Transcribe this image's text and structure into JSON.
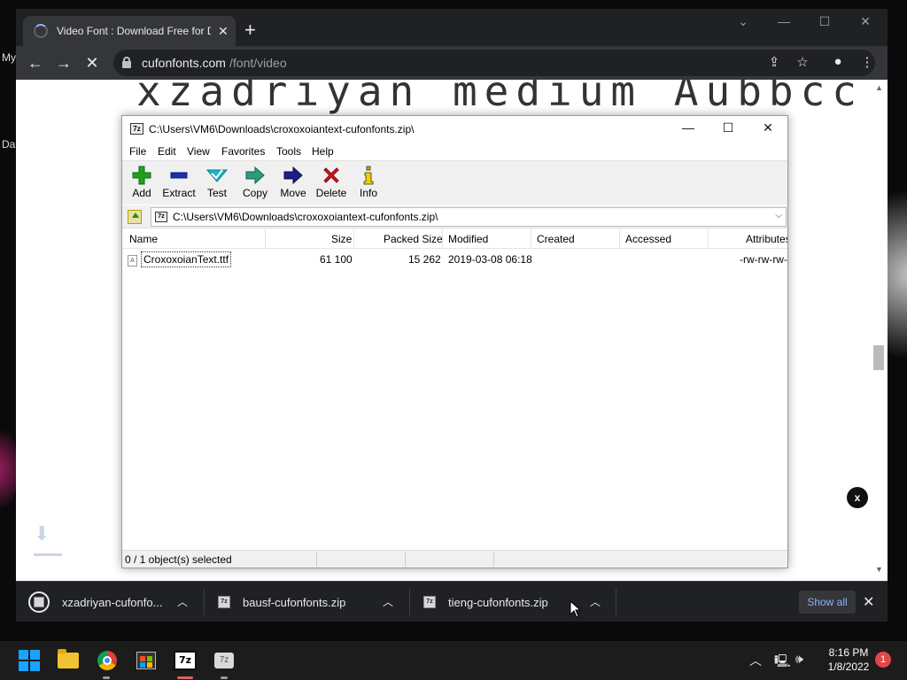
{
  "desktop": {
    "text_1": "My",
    "text_2": "Da"
  },
  "browser": {
    "tab": {
      "title": "Video Font : Download Free for Desktop & Webfont"
    },
    "address": {
      "host": "cufonfonts.com",
      "path": "/font/video"
    },
    "page": {
      "heading": "xzadriyan medium Aubbcc"
    },
    "close_overlay_label": "x"
  },
  "downloads_bar": {
    "items": [
      {
        "name": "xzadriyan-cufonfo..."
      },
      {
        "name": "bausf-cufonfonts.zip"
      },
      {
        "name": "tieng-cufonfonts.zip"
      }
    ],
    "show_all_label": "Show all"
  },
  "sevenzip": {
    "title": "C:\\Users\\VM6\\Downloads\\croxoxoiantext-cufonfonts.zip\\",
    "menu": [
      "File",
      "Edit",
      "View",
      "Favorites",
      "Tools",
      "Help"
    ],
    "toolbar": [
      {
        "label": "Add",
        "icon": "plus-icon",
        "color": "#1fa01f"
      },
      {
        "label": "Extract",
        "icon": "minus-icon",
        "color": "#1a2fb8"
      },
      {
        "label": "Test",
        "icon": "check-arrow-icon",
        "color": "#18b8c8"
      },
      {
        "label": "Copy",
        "icon": "double-arrow-icon",
        "color": "#2a9a80"
      },
      {
        "label": "Move",
        "icon": "right-arrow-icon",
        "color": "#1a1f80"
      },
      {
        "label": "Delete",
        "icon": "x-icon",
        "color": "#d01818"
      },
      {
        "label": "Info",
        "icon": "info-icon",
        "color": "#c8a800"
      }
    ],
    "address": "C:\\Users\\VM6\\Downloads\\croxoxoiantext-cufonfonts.zip\\",
    "columns": [
      "Name",
      "Size",
      "Packed Size",
      "Modified",
      "Created",
      "Accessed",
      "Attributes"
    ],
    "rows": [
      {
        "name": "CroxoxoianText.ttf",
        "size": "61 100",
        "packed_size": "15 262",
        "modified": "2019-03-08 06:18",
        "created": "",
        "accessed": "",
        "attributes": "-rw-rw-rw-"
      }
    ],
    "status": "0 / 1 object(s) selected"
  },
  "taskbar": {
    "time": "8:16 PM",
    "date": "1/8/2022",
    "notification_count": "1",
    "apps": [
      "windows-start-icon",
      "file-explorer-icon",
      "chrome-icon",
      "microsoft-store-icon",
      "7zip-icon",
      "app-icon"
    ]
  },
  "colors": {
    "chrome_dark": "#202124",
    "chrome_toolbar": "#35363a",
    "link_blue": "#8ab4f8",
    "win_blue": "#1aa3ff"
  }
}
